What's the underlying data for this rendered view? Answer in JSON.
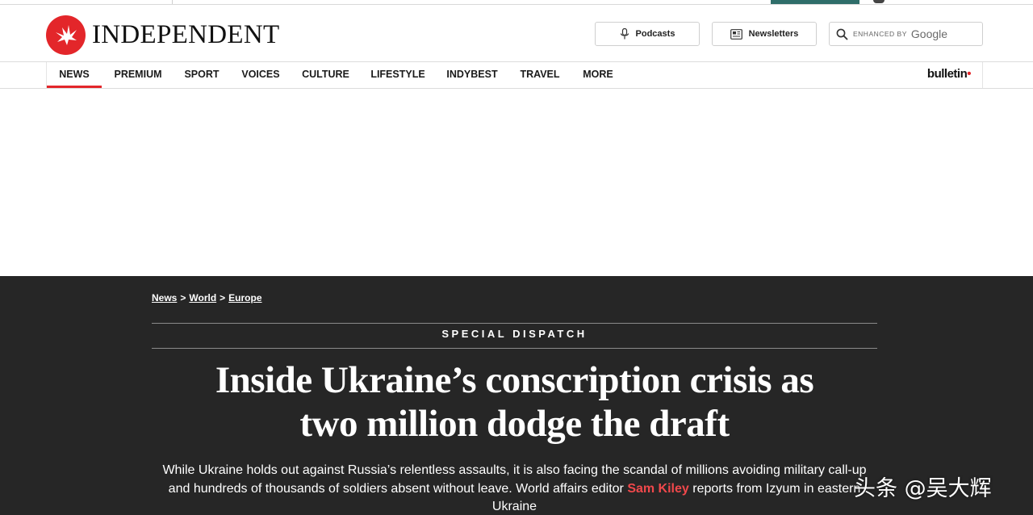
{
  "brand": {
    "name": "INDEPENDENT",
    "accent_color": "#e3262a",
    "logo_icon": "eagle-icon"
  },
  "header": {
    "podcasts_label": "Podcasts",
    "newsletters_label": "Newsletters",
    "search": {
      "enhanced_label": "ENHANCED BY",
      "provider_label": "Google"
    }
  },
  "nav": {
    "items": [
      {
        "label": "NEWS",
        "active": true
      },
      {
        "label": "PREMIUM"
      },
      {
        "label": "SPORT"
      },
      {
        "label": "VOICES"
      },
      {
        "label": "CULTURE"
      },
      {
        "label": "LIFESTYLE"
      },
      {
        "label": "INDYBEST"
      },
      {
        "label": "TRAVEL"
      },
      {
        "label": "MORE"
      }
    ],
    "partner_label": "bulletin"
  },
  "article": {
    "breadcrumb": [
      "News",
      "World",
      "Europe"
    ],
    "breadcrumb_separator": ">",
    "kicker": "SPECIAL DISPATCH",
    "headline_line1": "Inside Ukraine’s conscription crisis as",
    "headline_line2": "two million dodge the draft",
    "standfirst_before": "While Ukraine holds out against Russia’s relentless assaults, it is also facing the scandal of millions avoiding military call-up and hundreds of thousands of soldiers absent without leave. World affairs editor ",
    "standfirst_author": "Sam Kiley",
    "standfirst_after": " reports from Izyum in eastern Ukraine",
    "background_color": "#262626"
  },
  "watermark": {
    "text": "头条 @吴大辉"
  }
}
